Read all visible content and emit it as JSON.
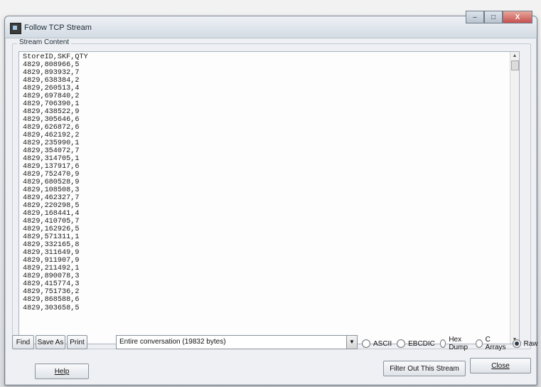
{
  "window": {
    "title": "Follow TCP Stream",
    "min_icon": "minimize-icon",
    "max_icon": "maximize-icon",
    "close_icon": "close-icon",
    "close_glyph": "X"
  },
  "stream": {
    "legend": "Stream Content",
    "lines": [
      "StoreID,SKF,QTY",
      "4829,808966,5",
      "4829,893932,7",
      "4829,638384,2",
      "4829,260513,4",
      "4829,697840,2",
      "4829,706390,1",
      "4829,438522,9",
      "4829,305646,6",
      "4829,626872,6",
      "4829,462192,2",
      "4829,235990,1",
      "4829,354072,7",
      "4829,314705,1",
      "4829,137917,6",
      "4829,752470,9",
      "4829,680528,9",
      "4829,108508,3",
      "4829,462327,7",
      "4829,220298,5",
      "4829,168441,4",
      "4829,410705,7",
      "4829,162926,5",
      "4829,571311,1",
      "4829,332165,8",
      "4829,311649,9",
      "4829,911907,9",
      "4829,211492,1",
      "4829,890078,3",
      "4829,415774,3",
      "4829,751736,2",
      "4829,868588,6",
      "4829,303658,5"
    ]
  },
  "toolbar": {
    "find_label": "Find",
    "save_as_label": "Save As",
    "print_label": "Print",
    "conversation_value": "Entire conversation (19832 bytes)",
    "format_options": [
      "ASCII",
      "EBCDIC",
      "Hex Dump",
      "C Arrays",
      "Raw"
    ],
    "selected_format": "Raw"
  },
  "footer": {
    "help_label": "Help",
    "filter_label": "Filter Out This Stream",
    "close_label": "Close"
  }
}
